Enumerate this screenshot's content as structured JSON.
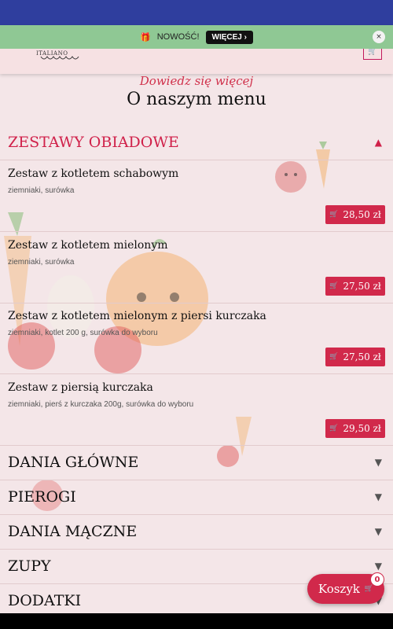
{
  "header": {
    "logo_text": "ALLA ITALIANO",
    "cart_icon": "cart-icon"
  },
  "notice": {
    "icon": "gift-icon",
    "text": "NOWOŚĆ!",
    "button": "WIĘCEJ",
    "close": "×"
  },
  "intro": {
    "subtitle": "Dowiedz się więcej",
    "title": "O naszym menu"
  },
  "sections": [
    {
      "title": "ZESTAWY OBIADOWE",
      "expanded": true
    },
    {
      "title": "DANIA GŁÓWNE",
      "expanded": false
    },
    {
      "title": "PIEROGI",
      "expanded": false
    },
    {
      "title": "DANIA MĄCZNE",
      "expanded": false
    },
    {
      "title": "ZUPY",
      "expanded": false
    },
    {
      "title": "DODATKI",
      "expanded": false
    }
  ],
  "items": [
    {
      "name": "Zestaw z kotletem schabowym",
      "desc": "ziemniaki, surówka",
      "price": "28,50 zł"
    },
    {
      "name": "Zestaw z kotletem mielonym",
      "desc": "ziemniaki, surówka",
      "price": "27,50 zł"
    },
    {
      "name": "Zestaw z kotletem mielonym z piersi kurczaka",
      "desc": "ziemniaki, kotlet 200 g, surówka do wyboru",
      "price": "27,50 zł"
    },
    {
      "name": "Zestaw z piersią kurczaka",
      "desc": "ziemniaki, pierś z kurczaka 200g, surówka do wyboru",
      "price": "29,50 zł"
    }
  ],
  "cart": {
    "label": "Koszyk",
    "count": "0"
  },
  "colors": {
    "accent": "#d1294b",
    "notice_bg": "#8fc894",
    "status_bar": "#2f3e9e",
    "page_bg": "#f4e6e8"
  }
}
